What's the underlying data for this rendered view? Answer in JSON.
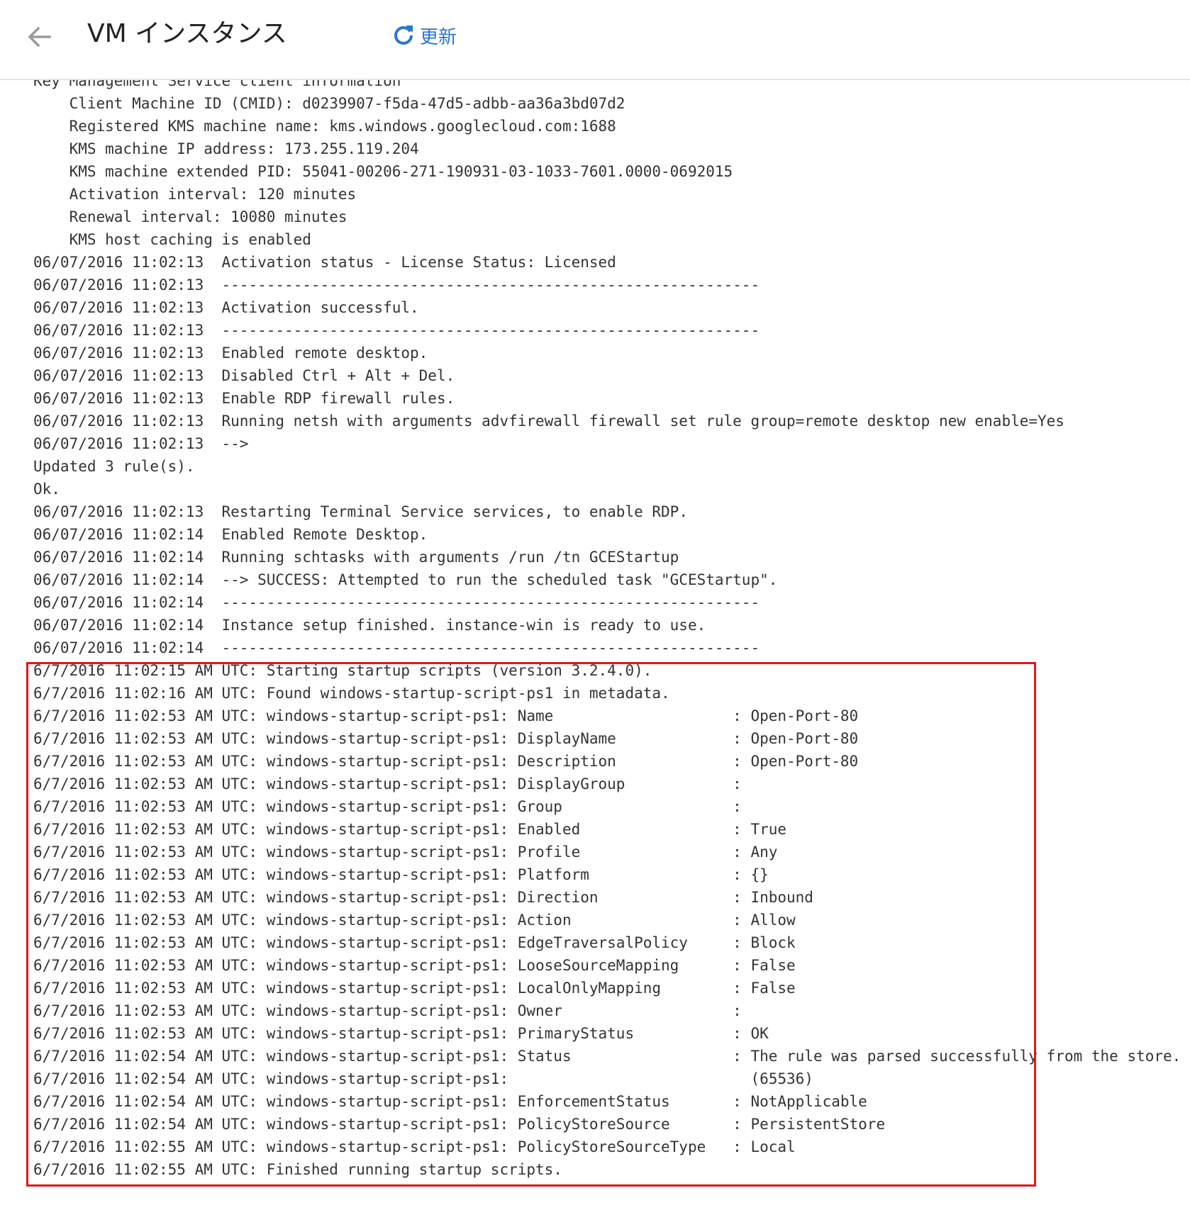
{
  "header": {
    "title": "VM インスタンス",
    "refresh_label": "更新",
    "accent_color": "#2a75d3"
  },
  "icons": {
    "back": "arrow-left-icon",
    "refresh": "refresh-icon"
  },
  "highlight": {
    "color": "#e01818"
  },
  "log_lines": [
    "Key Management Service client information",
    "    Client Machine ID (CMID): d0239907-f5da-47d5-adbb-aa36a3bd07d2",
    "    Registered KMS machine name: kms.windows.googlecloud.com:1688",
    "    KMS machine IP address: 173.255.119.204",
    "    KMS machine extended PID: 55041-00206-271-190931-03-1033-7601.0000-0692015",
    "    Activation interval: 120 minutes",
    "    Renewal interval: 10080 minutes",
    "    KMS host caching is enabled",
    "06/07/2016 11:02:13  Activation status - License Status: Licensed",
    "06/07/2016 11:02:13  ------------------------------------------------------------",
    "06/07/2016 11:02:13  Activation successful.",
    "06/07/2016 11:02:13  ------------------------------------------------------------",
    "06/07/2016 11:02:13  Enabled remote desktop.",
    "06/07/2016 11:02:13  Disabled Ctrl + Alt + Del.",
    "06/07/2016 11:02:13  Enable RDP firewall rules.",
    "06/07/2016 11:02:13  Running netsh with arguments advfirewall firewall set rule group=remote desktop new enable=Yes",
    "06/07/2016 11:02:13  -->",
    "Updated 3 rule(s).",
    "Ok.",
    "06/07/2016 11:02:13  Restarting Terminal Service services, to enable RDP.",
    "06/07/2016 11:02:14  Enabled Remote Desktop.",
    "06/07/2016 11:02:14  Running schtasks with arguments /run /tn GCEStartup",
    "06/07/2016 11:02:14  --> SUCCESS: Attempted to run the scheduled task \"GCEStartup\".",
    "06/07/2016 11:02:14  ------------------------------------------------------------",
    "06/07/2016 11:02:14  Instance setup finished. instance-win is ready to use.",
    "06/07/2016 11:02:14  ------------------------------------------------------------",
    "6/7/2016 11:02:15 AM UTC: Starting startup scripts (version 3.2.4.0).",
    "6/7/2016 11:02:16 AM UTC: Found windows-startup-script-ps1 in metadata.",
    "6/7/2016 11:02:53 AM UTC: windows-startup-script-ps1: Name                    : Open-Port-80",
    "6/7/2016 11:02:53 AM UTC: windows-startup-script-ps1: DisplayName             : Open-Port-80",
    "6/7/2016 11:02:53 AM UTC: windows-startup-script-ps1: Description             : Open-Port-80",
    "6/7/2016 11:02:53 AM UTC: windows-startup-script-ps1: DisplayGroup            :",
    "6/7/2016 11:02:53 AM UTC: windows-startup-script-ps1: Group                   :",
    "6/7/2016 11:02:53 AM UTC: windows-startup-script-ps1: Enabled                 : True",
    "6/7/2016 11:02:53 AM UTC: windows-startup-script-ps1: Profile                 : Any",
    "6/7/2016 11:02:53 AM UTC: windows-startup-script-ps1: Platform                : {}",
    "6/7/2016 11:02:53 AM UTC: windows-startup-script-ps1: Direction               : Inbound",
    "6/7/2016 11:02:53 AM UTC: windows-startup-script-ps1: Action                  : Allow",
    "6/7/2016 11:02:53 AM UTC: windows-startup-script-ps1: EdgeTraversalPolicy     : Block",
    "6/7/2016 11:02:53 AM UTC: windows-startup-script-ps1: LooseSourceMapping      : False",
    "6/7/2016 11:02:53 AM UTC: windows-startup-script-ps1: LocalOnlyMapping        : False",
    "6/7/2016 11:02:53 AM UTC: windows-startup-script-ps1: Owner                   :",
    "6/7/2016 11:02:53 AM UTC: windows-startup-script-ps1: PrimaryStatus           : OK",
    "6/7/2016 11:02:54 AM UTC: windows-startup-script-ps1: Status                  : The rule was parsed successfully from the store.",
    "6/7/2016 11:02:54 AM UTC: windows-startup-script-ps1:                           (65536)",
    "6/7/2016 11:02:54 AM UTC: windows-startup-script-ps1: EnforcementStatus       : NotApplicable",
    "6/7/2016 11:02:54 AM UTC: windows-startup-script-ps1: PolicyStoreSource       : PersistentStore",
    "6/7/2016 11:02:55 AM UTC: windows-startup-script-ps1: PolicyStoreSourceType   : Local",
    "6/7/2016 11:02:55 AM UTC: Finished running startup scripts."
  ]
}
